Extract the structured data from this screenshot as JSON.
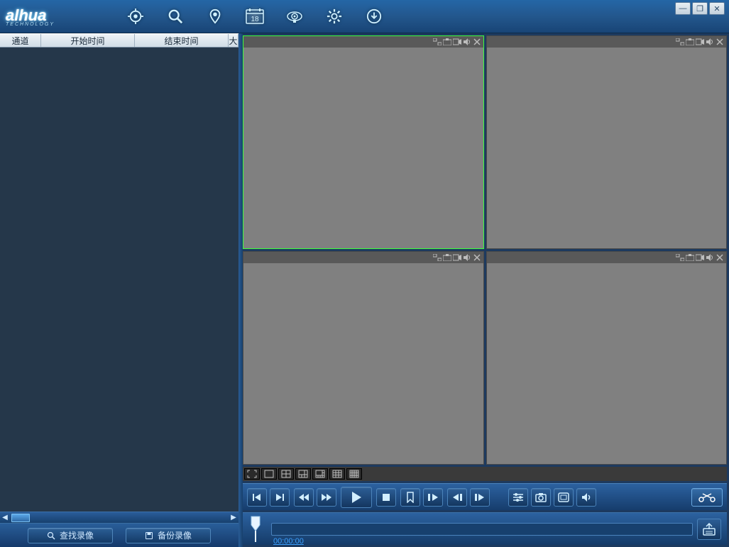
{
  "brand": {
    "name": "alhua",
    "sub": "TECHNOLOGY"
  },
  "window_controls": {
    "min": "—",
    "max": "❐",
    "close": "✕"
  },
  "nav": [
    {
      "name": "target-icon"
    },
    {
      "name": "search-icon"
    },
    {
      "name": "location-icon"
    },
    {
      "name": "calendar-icon",
      "badge": "18",
      "active": true
    },
    {
      "name": "camera-icon"
    },
    {
      "name": "gear-icon"
    },
    {
      "name": "download-icon"
    }
  ],
  "left": {
    "columns": {
      "c1": "通道",
      "c2": "开始时间",
      "c3": "结束时间",
      "c4": "大"
    },
    "buttons": {
      "search": "查找录像",
      "backup": "备份录像"
    }
  },
  "pane_icons": [
    "expand-icon",
    "snapshot-icon",
    "record-icon",
    "sound-icon",
    "close-icon"
  ],
  "layouts": [
    "full",
    "1",
    "4",
    "6",
    "8",
    "9",
    "16"
  ],
  "controls": {
    "first": "",
    "next_rec": "",
    "rw": "",
    "ff": "",
    "play": "",
    "stop": "",
    "mark": "",
    "step_pause": "",
    "frame_back": "",
    "frame_fwd": "",
    "adjust": "",
    "snapshot": "",
    "zoom": "",
    "volume": ""
  },
  "timeline": {
    "time": "00:00:00"
  }
}
